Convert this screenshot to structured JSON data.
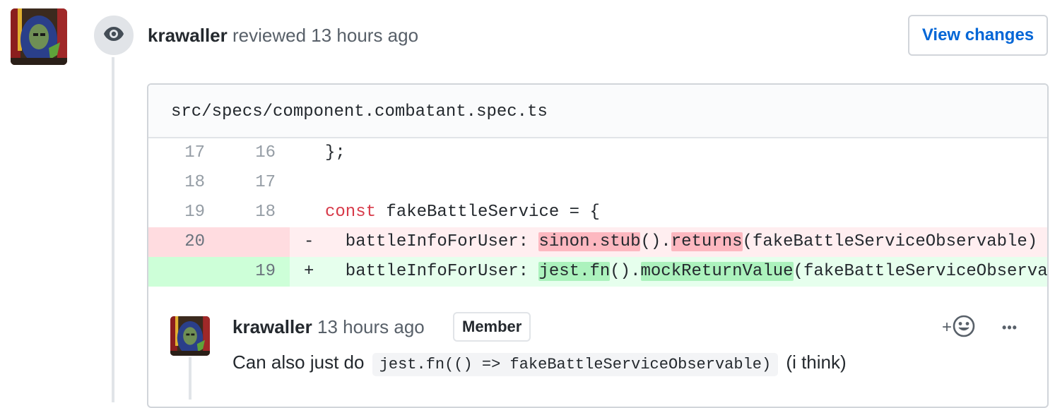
{
  "review": {
    "author": "krawaller",
    "action": "reviewed",
    "time": "13 hours ago",
    "view_changes_label": "View changes"
  },
  "file": {
    "path": "src/specs/component.combatant.spec.ts"
  },
  "diff": {
    "rows": [
      {
        "old": "17",
        "new": "16",
        "sign": "",
        "code": "};"
      },
      {
        "old": "18",
        "new": "17",
        "sign": "",
        "code": ""
      },
      {
        "old": "19",
        "new": "18",
        "sign": "",
        "keyword": "const",
        "code": " fakeBattleService = {"
      },
      {
        "old": "20",
        "new": "",
        "sign": "-",
        "code_parts": [
          "  battleInfoForUser: ",
          "sinon.stub",
          "().",
          "returns",
          "(fakeBattleServiceObservable)"
        ]
      },
      {
        "old": "",
        "new": "19",
        "sign": "+",
        "code_parts": [
          "  battleInfoForUser: ",
          "jest.fn",
          "().",
          "mockReturnValue",
          "(fakeBattleServiceObserva"
        ]
      }
    ]
  },
  "comment": {
    "author": "krawaller",
    "time": "13 hours ago",
    "badge": "Member",
    "text_before": "Can also just do",
    "code": "jest.fn(() => fakeBattleServiceObservable)",
    "text_after": "(i think)",
    "reaction_label": "+",
    "more_label": "•••"
  },
  "colors": {
    "link": "#0366d6",
    "deletion_bg": "#ffeef0",
    "deletion_highlight": "#fdb8c0",
    "addition_bg": "#e6ffed",
    "addition_highlight": "#acf2bd",
    "keyword": "#d73a49"
  },
  "icons": {
    "timeline": "eye-icon",
    "reaction": "smiley-icon",
    "more": "kebab-horizontal-icon"
  }
}
